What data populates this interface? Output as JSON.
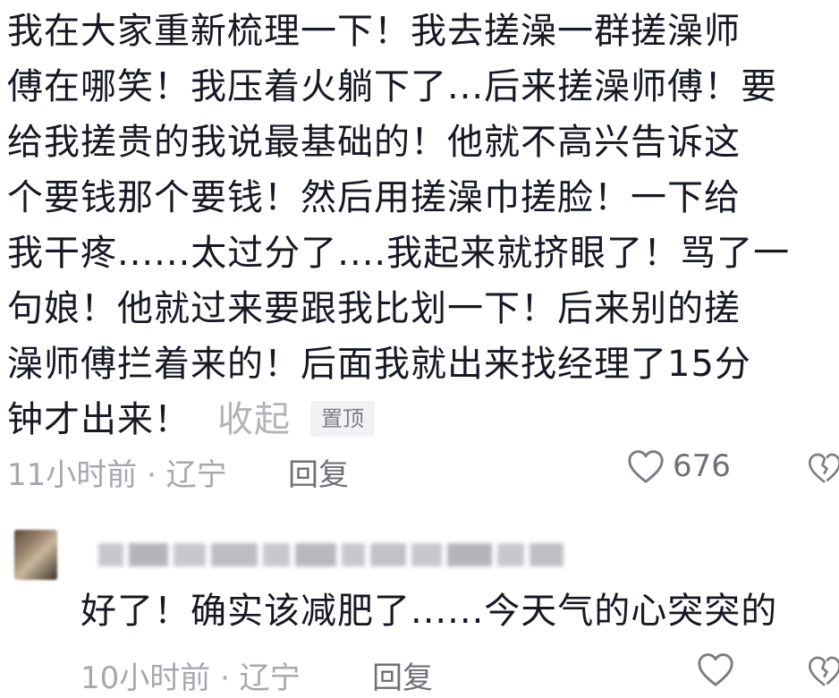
{
  "main_comment": {
    "lines": [
      "我在大家重新梳理一下！我去搓澡一群搓澡师",
      "傅在哪笑！我压着火躺下了...后来搓澡师傅！要",
      "给我搓贵的我说最基础的！他就不高兴告诉这",
      "个要钱那个要钱！然后用搓澡巾搓脸！一下给",
      "我干疼......太过分了....我起来就挤眼了！骂了一",
      "句娘！他就过来要跟我比划一下！后来别的搓",
      "澡师傅拦着来的！后面我就出来找经理了15分",
      "钟才出来！"
    ],
    "collapse_label": "收起",
    "pin_label": "置顶",
    "time_location": "11小时前 · 辽宁",
    "reply_label": "回复",
    "like_count": "676"
  },
  "reply_comment": {
    "text": "好了！确实该减肥了......今天气的心突突的",
    "time_location": "10小时前 · 辽宁",
    "reply_label": "回复",
    "like_count": ""
  },
  "icons": {
    "like": "heart-outline-icon",
    "dislike": "broken-heart-icon"
  },
  "colors": {
    "text": "#161823",
    "meta": "#a7a8ae",
    "action": "#6f7077",
    "badge_bg": "#f2f2f4"
  }
}
